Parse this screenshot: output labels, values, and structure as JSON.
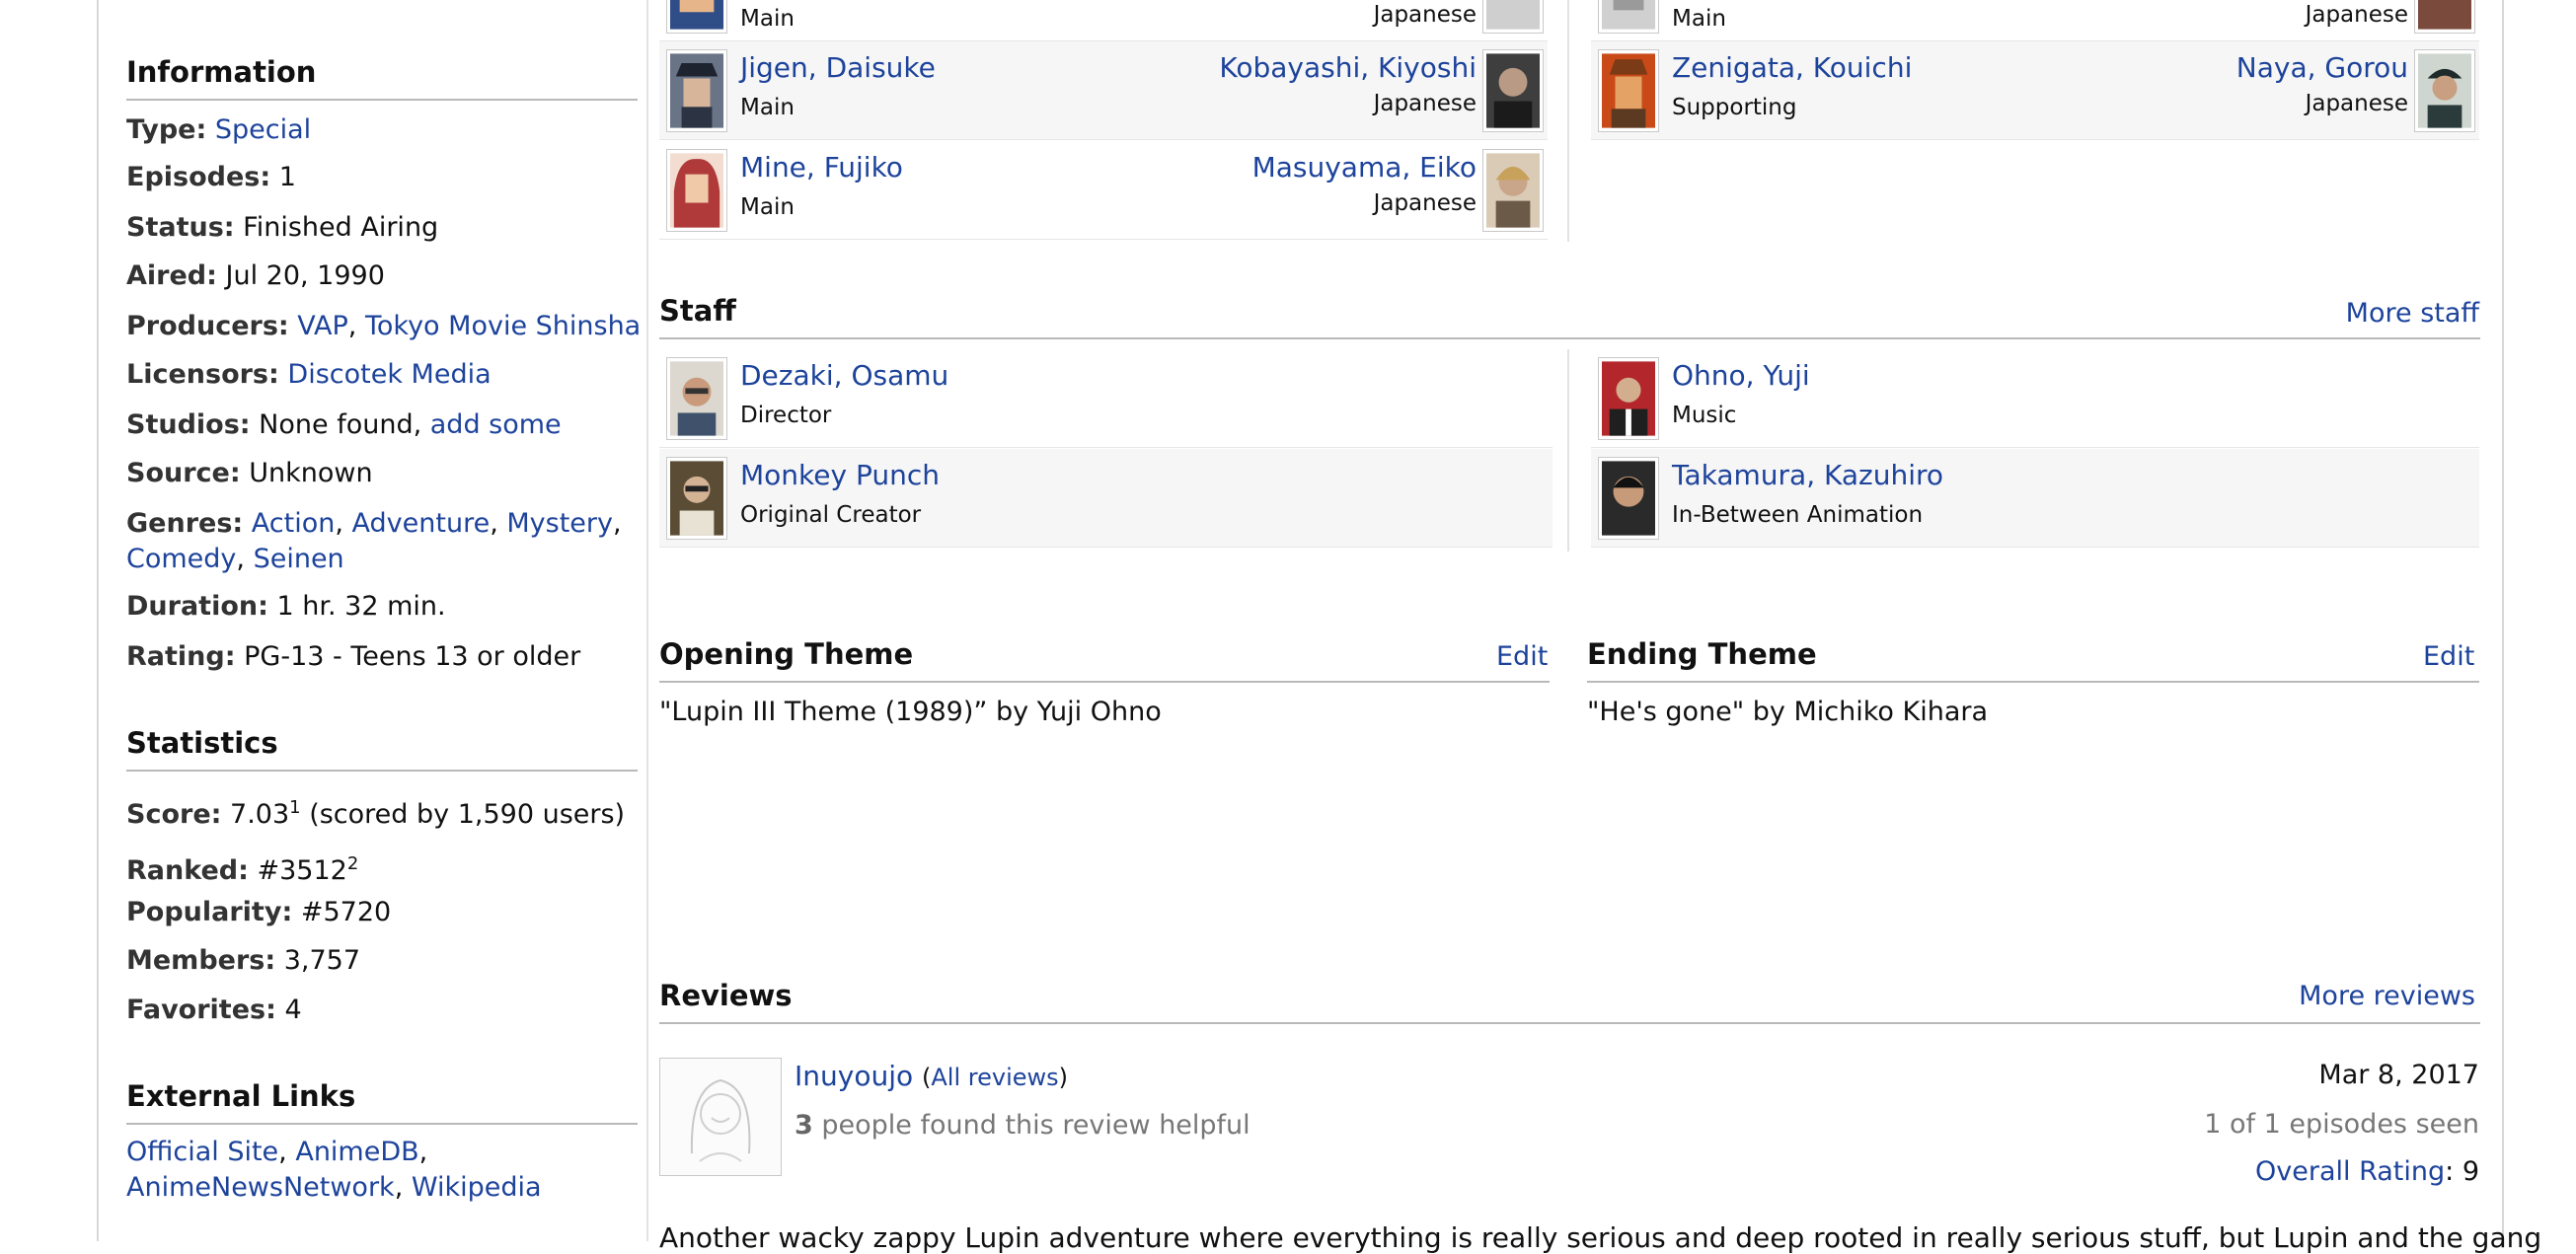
{
  "sidebar": {
    "information_heading": "Information",
    "info": {
      "type_label": "Type:",
      "type_value": "Special",
      "episodes_label": "Episodes:",
      "episodes_value": "1",
      "status_label": "Status:",
      "status_value": "Finished Airing",
      "aired_label": "Aired:",
      "aired_value": "Jul 20, 1990",
      "producers_label": "Producers:",
      "producers": [
        "VAP",
        "Tokyo Movie Shinsha"
      ],
      "licensors_label": "Licensors:",
      "licensors": [
        "Discotek Media"
      ],
      "studios_label": "Studios:",
      "studios_value": "None found,",
      "studios_link": "add some",
      "source_label": "Source:",
      "source_value": "Unknown",
      "genres_label": "Genres:",
      "genres": [
        "Action",
        "Adventure",
        "Mystery",
        "Comedy",
        "Seinen"
      ],
      "duration_label": "Duration:",
      "duration_value": "1 hr. 32 min.",
      "rating_label": "Rating:",
      "rating_value": "PG-13 - Teens 13 or older"
    },
    "statistics_heading": "Statistics",
    "stats": {
      "score_label": "Score:",
      "score_value": "7.03",
      "score_sup": "1",
      "score_note": "(scored by 1,590 users)",
      "ranked_label": "Ranked:",
      "ranked_value": "#3512",
      "ranked_sup": "2",
      "popularity_label": "Popularity:",
      "popularity_value": "#5720",
      "members_label": "Members:",
      "members_value": "3,757",
      "favorites_label": "Favorites:",
      "favorites_value": "4"
    },
    "external_heading": "External Links",
    "external_links": [
      "Official Site",
      "AnimeDB",
      "AnimeNewsNetwork",
      "Wikipedia"
    ]
  },
  "characters": {
    "left": [
      {
        "name": "",
        "role": "Main",
        "va": "",
        "lang": "Japanese"
      },
      {
        "name": "Jigen, Daisuke",
        "role": "Main",
        "va": "Kobayashi, Kiyoshi",
        "lang": "Japanese"
      },
      {
        "name": "Mine, Fujiko",
        "role": "Main",
        "va": "Masuyama, Eiko",
        "lang": "Japanese"
      }
    ],
    "right": [
      {
        "name": "",
        "role": "Main",
        "va": "",
        "lang": "Japanese"
      },
      {
        "name": "Zenigata, Kouichi",
        "role": "Supporting",
        "va": "Naya, Gorou",
        "lang": "Japanese"
      }
    ]
  },
  "staff": {
    "heading": "Staff",
    "more_link": "More staff",
    "left": [
      {
        "name": "Dezaki, Osamu",
        "role": "Director"
      },
      {
        "name": "Monkey Punch",
        "role": "Original Creator"
      }
    ],
    "right": [
      {
        "name": "Ohno, Yuji",
        "role": "Music"
      },
      {
        "name": "Takamura, Kazuhiro",
        "role": "In-Between Animation"
      }
    ]
  },
  "themes": {
    "opening_heading": "Opening Theme",
    "opening_edit": "Edit",
    "opening_text": "\"Lupin III Theme (1989)” by Yuji Ohno",
    "ending_heading": "Ending Theme",
    "ending_edit": "Edit",
    "ending_text": "\"He's gone\" by Michiko Kihara"
  },
  "reviews": {
    "heading": "Reviews",
    "more_link": "More reviews",
    "items": [
      {
        "reviewer": "Inuyoujo",
        "all_reviews_open": "(",
        "all_reviews": "All reviews",
        "all_reviews_close": ")",
        "helpful_count": "3",
        "helpful_text": "people found this review helpful",
        "date": "Mar 8, 2017",
        "episodes_seen": "1 of 1 episodes seen",
        "overall_label": "Overall Rating",
        "overall_value": ": 9",
        "body_start": "Another wacky zappy Lupin adventure where everything is really serious and deep rooted in really serious stuff, but Lupin and the gang"
      }
    ]
  },
  "colors": {
    "link": "#1d439b",
    "row_shade": "#f6f6f6",
    "rule": "#b9b9b9"
  }
}
